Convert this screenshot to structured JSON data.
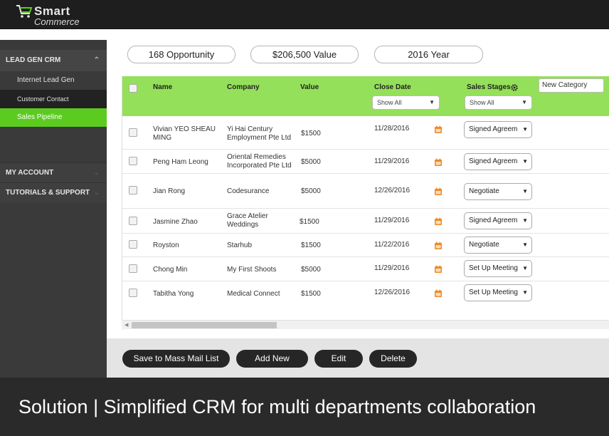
{
  "brand": {
    "line1": "Smart",
    "line2": "Commerce"
  },
  "sidebar": {
    "sections": [
      {
        "label": "LEAD GEN CRM",
        "expanded": true
      },
      {
        "label": "MY ACCOUNT",
        "expanded": false
      },
      {
        "label": "TUTORIALS & SUPPORT",
        "expanded": false
      }
    ],
    "items": [
      {
        "label": "Internet Lead Gen",
        "active": false
      },
      {
        "label": "Customer Contact",
        "active": false
      },
      {
        "label": "Sales Pipeline",
        "active": true
      }
    ]
  },
  "summary": {
    "opportunity": "168 Opportunity",
    "value": "$206,500 Value",
    "year": "2016 Year"
  },
  "table": {
    "columns": {
      "name": "Name",
      "company": "Company",
      "value": "Value",
      "close_date": "Close Date",
      "sales_stages": "Sales Stages"
    },
    "filters": {
      "close_date": "Show All",
      "sales_stages": "Show All"
    },
    "new_category_placeholder": "New Category",
    "rows": [
      {
        "name": "Vivian YEO SHEAU MING",
        "company": "Yi Hai Century Employment Pte Ltd",
        "value": "$1500",
        "close_date": "11/28/2016",
        "stage": "Signed Agreem"
      },
      {
        "name": "Peng Ham Leong",
        "company": "Oriental Remedies Incorporated Pte Ltd",
        "value": "$5000",
        "close_date": "11/29/2016",
        "stage": "Signed Agreem"
      },
      {
        "name": "Jian Rong",
        "company": "Codesurance",
        "value": "$5000",
        "close_date": "12/26/2016",
        "stage": "Negotiate"
      },
      {
        "name": "Jasmine Zhao",
        "company": "Grace Atelier Weddings",
        "value": "$1500",
        "close_date": "11/29/2016",
        "stage": "Signed Agreem"
      },
      {
        "name": "Royston",
        "company": "Starhub",
        "value": "$1500",
        "close_date": "11/22/2016",
        "stage": "Negotiate"
      },
      {
        "name": "Chong Min",
        "company": "My First Shoots",
        "value": "$5000",
        "close_date": "11/29/2016",
        "stage": "Set Up Meeting"
      },
      {
        "name": "Tabitha Yong",
        "company": "Medical Connect",
        "value": "$1500",
        "close_date": "12/26/2016",
        "stage": "Set Up Meeting"
      }
    ]
  },
  "actions": {
    "mass_mail": "Save to Mass Mail List",
    "add_new": "Add New",
    "edit": "Edit",
    "delete": "Delete"
  },
  "caption": "Solution | Simplified CRM for multi departments collaboration",
  "colors": {
    "header_green": "#95e05a",
    "active_nav": "#5ccb1f",
    "calendar_orange": "#f08a24",
    "dark_button": "#262626"
  },
  "icons": [
    "cart-icon",
    "chevron-up-icon",
    "chevron-down-icon",
    "gear-icon",
    "calendar-icon",
    "caret-down-icon"
  ]
}
